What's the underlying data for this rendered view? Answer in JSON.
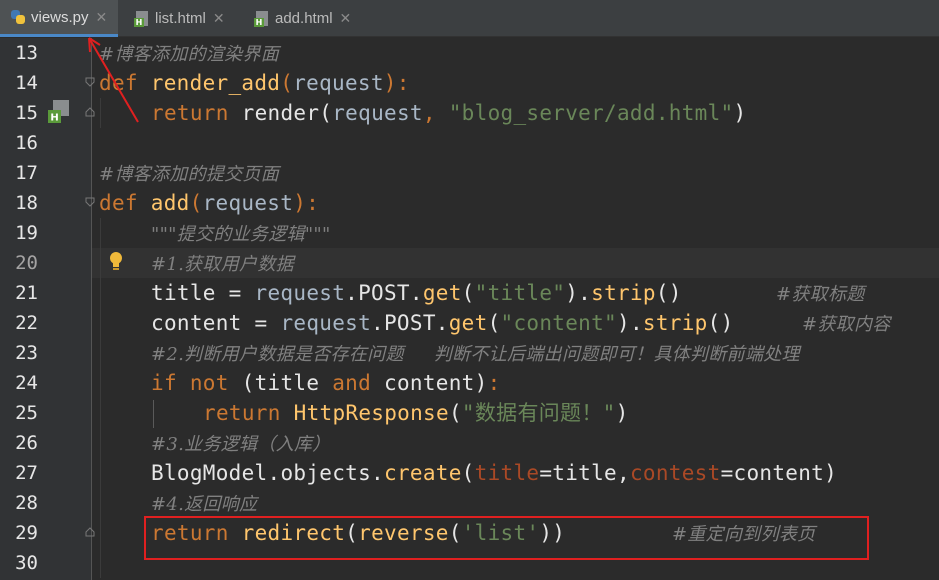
{
  "tabs": [
    {
      "label": "views.py",
      "icon": "python-file-icon",
      "active": true
    },
    {
      "label": "list.html",
      "icon": "html-file-icon",
      "active": false
    },
    {
      "label": "add.html",
      "icon": "html-file-icon",
      "active": false
    }
  ],
  "line_numbers": [
    "13",
    "14",
    "15",
    "16",
    "17",
    "18",
    "19",
    "20",
    "21",
    "22",
    "23",
    "24",
    "25",
    "26",
    "27",
    "28",
    "29",
    "30"
  ],
  "code": {
    "l13_comment": "#博客添加的渲染界面",
    "l14_def": "def",
    "l14_name": "render_add",
    "l14_open": "(",
    "l14_param": "request",
    "l14_close": "):",
    "l15_return": "return",
    "l15_call": "render(",
    "l15_arg": "request",
    "l15_sep": ", ",
    "l15_str": "\"blog_server/add.html\"",
    "l15_end": ")",
    "l17_comment": "#博客添加的提交页面",
    "l18_def": "def",
    "l18_name": "add",
    "l18_open": "(",
    "l18_param": "request",
    "l18_close": "):",
    "l19_docstring": "\"\"\"提交的业务逻辑\"\"\"",
    "l20_comment": "#1.获取用户数据",
    "l21_var": "title = ",
    "l21_req": "request",
    "l21_post": ".POST.",
    "l21_get": "get",
    "l21_open": "(",
    "l21_str": "\"title\"",
    "l21_close": ").",
    "l21_strip": "strip",
    "l21_paren": "()",
    "l21_comment": "#获取标题",
    "l22_var": "content = ",
    "l22_req": "request",
    "l22_post": ".POST.",
    "l22_get": "get",
    "l22_open": "(",
    "l22_str": "\"content\"",
    "l22_close": ").",
    "l22_strip": "strip",
    "l22_paren": "()",
    "l22_comment": "#获取内容",
    "l23_comment": "#2.判断用户数据是否存在问题     判断不让后端出问题即可！具体判断前端处理",
    "l24_if": "if",
    "l24_not": "not",
    "l24_a": " (title ",
    "l24_and": "and",
    "l24_b": " content)",
    "l24_colon": ":",
    "l25_return": "return",
    "l25_call": "HttpResponse",
    "l25_open": "(",
    "l25_str": "\"数据有问题！\"",
    "l25_close": ")",
    "l26_comment": "#3.业务逻辑（入库）",
    "l27_model": "BlogModel",
    "l27_objects": ".objects.",
    "l27_create": "create",
    "l27_open": "(",
    "l27_kw1": "title",
    "l27_eq1": "=title,",
    "l27_kw2": "contest",
    "l27_eq2": "=content)",
    "l28_comment": "#4.返回响应",
    "l29_return": "return",
    "l29_call": "redirect",
    "l29_open": "(",
    "l29_reverse": "reverse",
    "l29_open2": "(",
    "l29_str": "'list'",
    "l29_close": "))",
    "l29_comment": "#重定向到列表页"
  },
  "colors": {
    "background": "#2b2b2b",
    "keyword": "#cc7832",
    "function": "#ffc66d",
    "string": "#6a8759",
    "comment": "#808080",
    "annotation_box": "#e02020"
  },
  "icons": {
    "lightbulb": "lightbulb-icon",
    "gutter_html": "html-file-icon",
    "arrow": "red-arrow-annotation"
  }
}
